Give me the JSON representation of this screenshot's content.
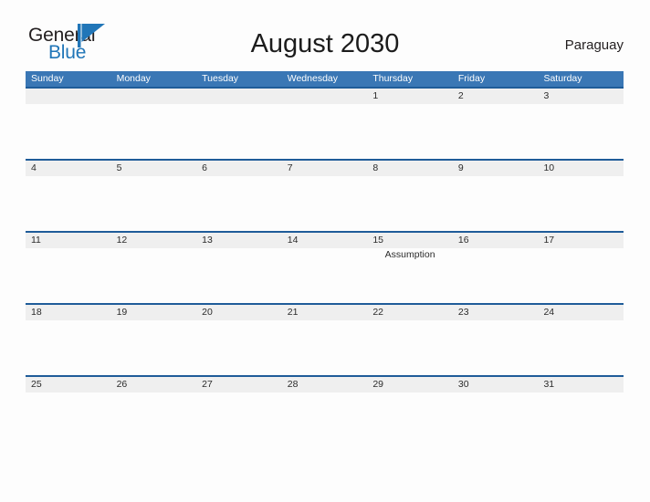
{
  "brand": {
    "name_part1": "General",
    "name_part2": "Blue",
    "flag_icon": "triangle-flag-icon",
    "accent_color": "#2176b8",
    "text_color": "#231f20"
  },
  "header": {
    "title": "August 2030",
    "region": "Paraguay"
  },
  "colors": {
    "weekday_header_bg": "#3a77b5",
    "week_divider": "#1f5c99",
    "date_band_bg": "#efefef",
    "page_bg": "#fdfdfd"
  },
  "calendar": {
    "weekdays": [
      "Sunday",
      "Monday",
      "Tuesday",
      "Wednesday",
      "Thursday",
      "Friday",
      "Saturday"
    ],
    "weeks": [
      {
        "days": [
          {
            "num": "",
            "event": ""
          },
          {
            "num": "",
            "event": ""
          },
          {
            "num": "",
            "event": ""
          },
          {
            "num": "",
            "event": ""
          },
          {
            "num": "1",
            "event": ""
          },
          {
            "num": "2",
            "event": ""
          },
          {
            "num": "3",
            "event": ""
          }
        ]
      },
      {
        "days": [
          {
            "num": "4",
            "event": ""
          },
          {
            "num": "5",
            "event": ""
          },
          {
            "num": "6",
            "event": ""
          },
          {
            "num": "7",
            "event": ""
          },
          {
            "num": "8",
            "event": ""
          },
          {
            "num": "9",
            "event": ""
          },
          {
            "num": "10",
            "event": ""
          }
        ]
      },
      {
        "days": [
          {
            "num": "11",
            "event": ""
          },
          {
            "num": "12",
            "event": ""
          },
          {
            "num": "13",
            "event": ""
          },
          {
            "num": "14",
            "event": ""
          },
          {
            "num": "15",
            "event": "Assumption"
          },
          {
            "num": "16",
            "event": ""
          },
          {
            "num": "17",
            "event": ""
          }
        ]
      },
      {
        "days": [
          {
            "num": "18",
            "event": ""
          },
          {
            "num": "19",
            "event": ""
          },
          {
            "num": "20",
            "event": ""
          },
          {
            "num": "21",
            "event": ""
          },
          {
            "num": "22",
            "event": ""
          },
          {
            "num": "23",
            "event": ""
          },
          {
            "num": "24",
            "event": ""
          }
        ]
      },
      {
        "days": [
          {
            "num": "25",
            "event": ""
          },
          {
            "num": "26",
            "event": ""
          },
          {
            "num": "27",
            "event": ""
          },
          {
            "num": "28",
            "event": ""
          },
          {
            "num": "29",
            "event": ""
          },
          {
            "num": "30",
            "event": ""
          },
          {
            "num": "31",
            "event": ""
          }
        ]
      }
    ]
  }
}
